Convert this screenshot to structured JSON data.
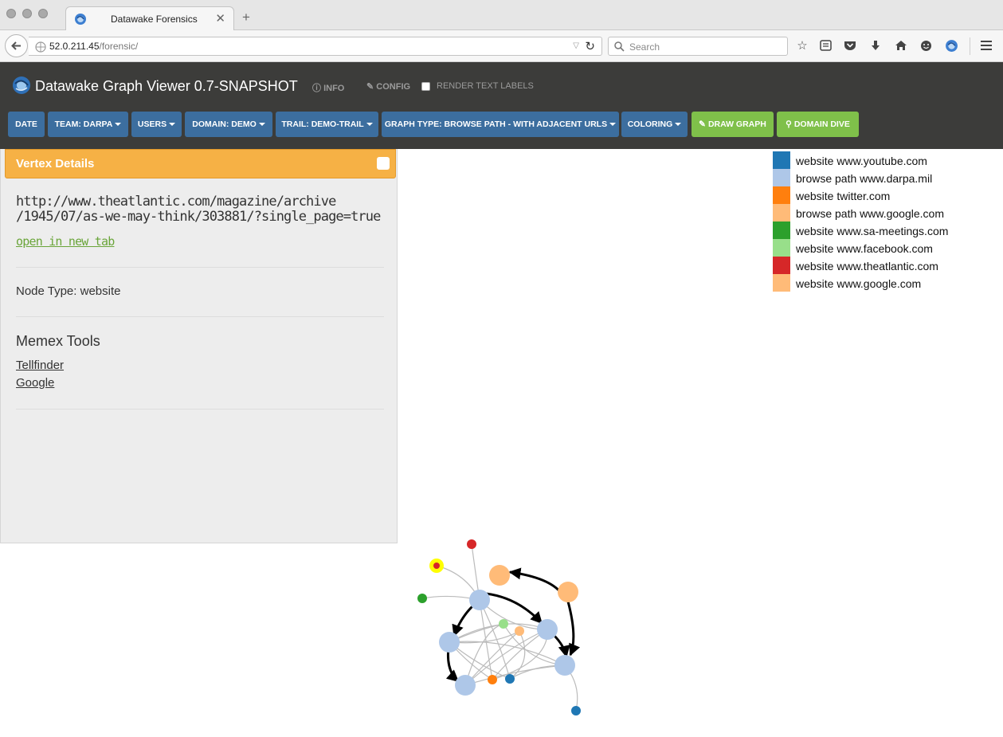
{
  "browser": {
    "tab_title": "Datawake Forensics",
    "url_host": "52.0.211.45",
    "url_path": "/forensic/",
    "search_placeholder": "Search"
  },
  "app": {
    "brand": "Datawake Graph Viewer 0.7-SNAPSHOT",
    "info_label": "INFO",
    "config_label": "CONFIG",
    "render_labels": "RENDER TEXT LABELS",
    "toolbar": {
      "date": "DATE",
      "team": "TEAM: DARPA",
      "users": "USERS",
      "domain": "DOMAIN: DEMO",
      "trail": "TRAIL: DEMO-TRAIL",
      "graph_type": "GRAPH TYPE: BROWSE PATH - WITH ADJACENT URLS",
      "coloring": "COLORING",
      "draw_graph": "DRAW GRAPH",
      "domain_dive": "DOMAIN DIVE"
    }
  },
  "panel": {
    "title": "Vertex Details",
    "url_line1": "http://www.theatlantic.com/magazine/archive",
    "url_line2": "/1945/07/as-we-may-think/303881/?single_page=true",
    "open_link": "open in new tab",
    "node_type": "Node Type: website",
    "tools_heading": "Memex Tools",
    "tools": [
      "Tellfinder",
      "Google"
    ]
  },
  "legend": [
    {
      "label": "website www.youtube.com",
      "color": "#1f77b4"
    },
    {
      "label": "browse path www.darpa.mil",
      "color": "#aec7e8"
    },
    {
      "label": "website twitter.com",
      "color": "#ff7f0e"
    },
    {
      "label": "browse path www.google.com",
      "color": "#ffbb78"
    },
    {
      "label": "website www.sa-meetings.com",
      "color": "#2ca02c"
    },
    {
      "label": "website www.facebook.com",
      "color": "#98df8a"
    },
    {
      "label": "website www.theatlantic.com",
      "color": "#d62728"
    },
    {
      "label": "website www.google.com",
      "color": "#ffbb78"
    }
  ]
}
